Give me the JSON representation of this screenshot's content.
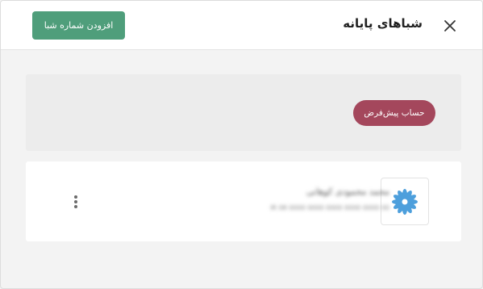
{
  "header": {
    "title": "شباهای پایانه",
    "add_button_label": "افزودن شماره شبا",
    "close_icon": "close-icon"
  },
  "default_section": {
    "badge_label": "حساب پیش‌فرض"
  },
  "accounts": [
    {
      "name": "محمد محمودی کوهانی",
      "number": "IR 08 0000 0000 0000 0000 0000 00",
      "logo_icon": "bank-logo-icon",
      "menu_icon": "more-vertical-icon"
    }
  ],
  "colors": {
    "primary_green": "#4f9e7b",
    "badge_maroon": "#a4475c",
    "logo_blue": "#2f8fd6"
  }
}
